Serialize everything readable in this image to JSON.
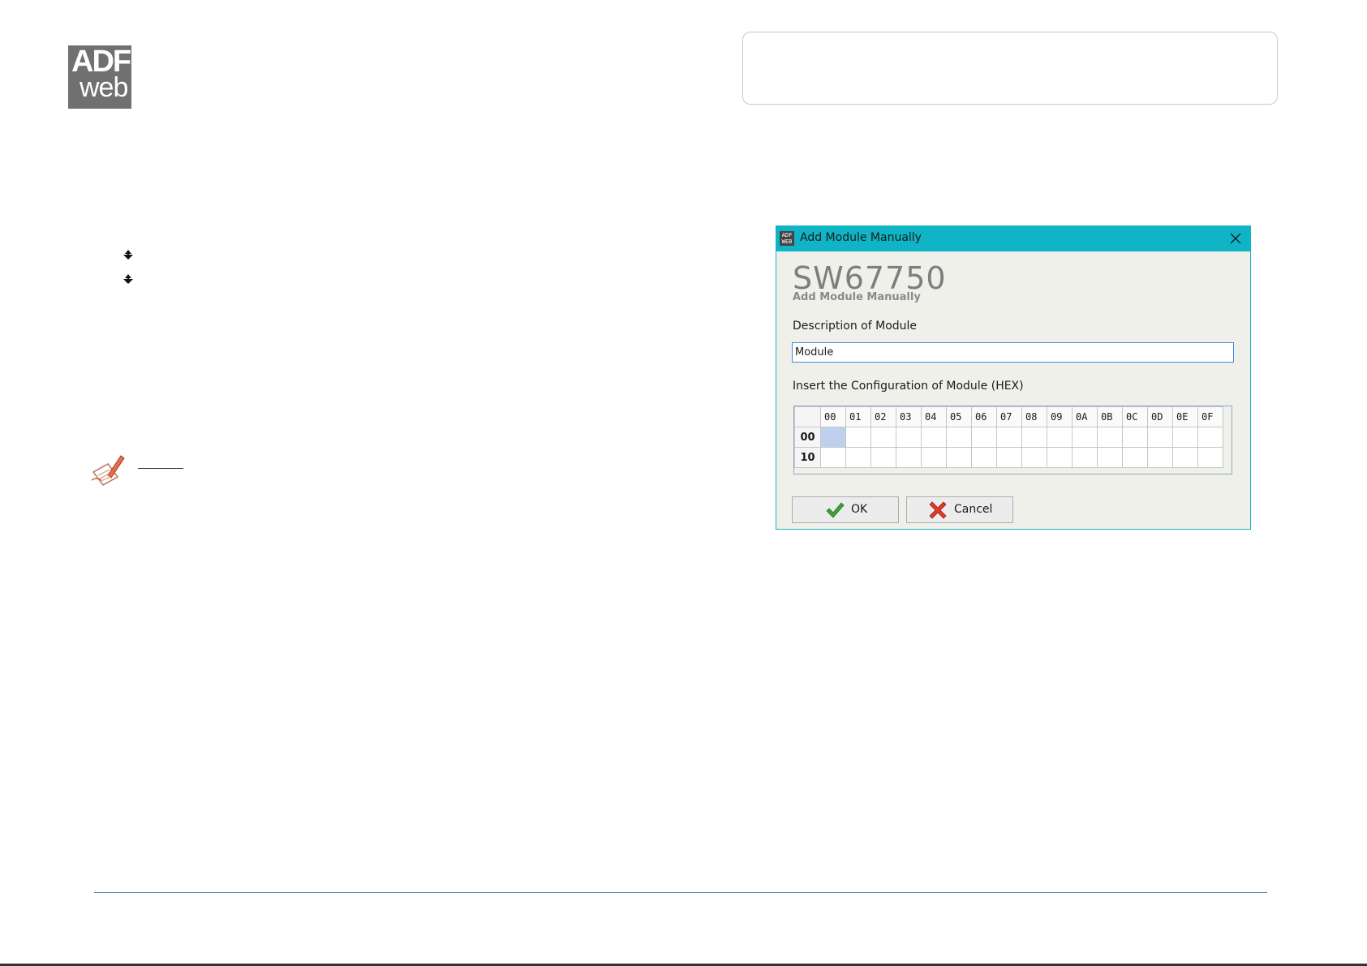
{
  "logo": {
    "line1": "ADF",
    "line2": "web"
  },
  "dialog": {
    "title": "Add Module Manually",
    "product_code": "SW67750",
    "subtitle": "Add Module Manually",
    "description_label": "Description of Module",
    "description_value": "Module",
    "config_label": "Insert the Configuration of Module (HEX)",
    "grid": {
      "columns": [
        "00",
        "01",
        "02",
        "03",
        "04",
        "05",
        "06",
        "07",
        "08",
        "09",
        "0A",
        "0B",
        "0C",
        "0D",
        "0E",
        "0F"
      ],
      "rows": [
        "00",
        "10"
      ],
      "selected_cell": {
        "row": "00",
        "col": "00"
      }
    },
    "ok_label": "OK",
    "cancel_label": "Cancel"
  },
  "colors": {
    "titlebar": "#0fb5c6",
    "dialog_bg": "#f0f0eb",
    "selected_cell": "#bdd0ee",
    "footer_rule": "#4a7cb8"
  },
  "icons": {
    "bullet": "diamond-arrow-bullet-icon",
    "note": "note-pencil-icon",
    "ok": "checkmark-icon",
    "cancel": "red-x-icon",
    "close": "close-icon"
  }
}
